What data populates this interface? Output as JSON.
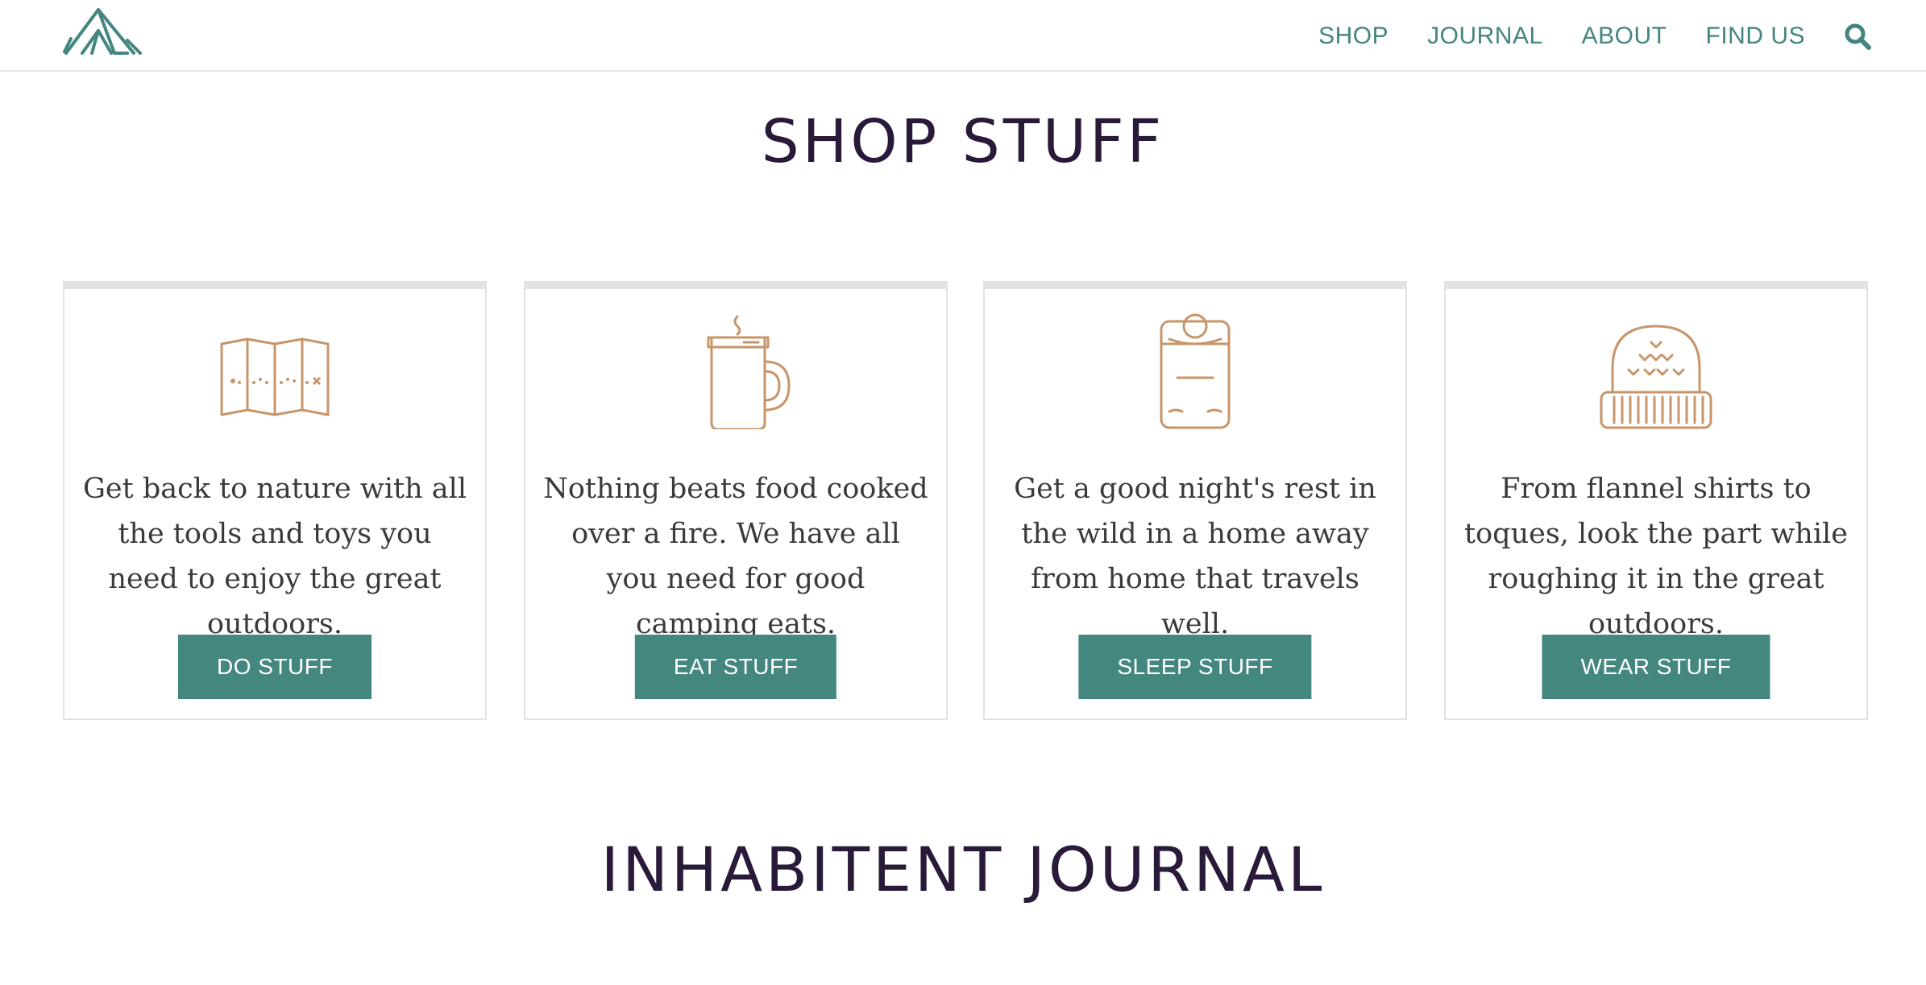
{
  "colors": {
    "accent": "#44877f",
    "nav_text": "#44857f",
    "heading": "#2a1a3a",
    "icon_stroke": "#c8956a",
    "body_text": "#3a3a3a",
    "border": "#e2e2e2"
  },
  "header": {
    "logo_icon": "tent-logo-icon",
    "nav": [
      {
        "label": "SHOP"
      },
      {
        "label": "JOURNAL"
      },
      {
        "label": "ABOUT"
      },
      {
        "label": "FIND US"
      }
    ],
    "search_icon": "search-icon"
  },
  "shop": {
    "title": "SHOP STUFF",
    "cards": [
      {
        "icon": "map-icon",
        "text": "Get back to nature with all the tools and toys you need to enjoy the great outdoors.",
        "button": "DO STUFF"
      },
      {
        "icon": "mug-icon",
        "text": "Nothing beats food cooked over a fire. We have all you need for good camping eats.",
        "button": "EAT STUFF"
      },
      {
        "icon": "sleeping-bag-icon",
        "text": "Get a good night's rest in the wild in a home away from home that travels well.",
        "button": "SLEEP STUFF"
      },
      {
        "icon": "toque-icon",
        "text": "From flannel shirts to toques, look the part while roughing it in the great outdoors.",
        "button": "WEAR STUFF"
      }
    ]
  },
  "journal": {
    "title": "INHABITENT JOURNAL"
  }
}
